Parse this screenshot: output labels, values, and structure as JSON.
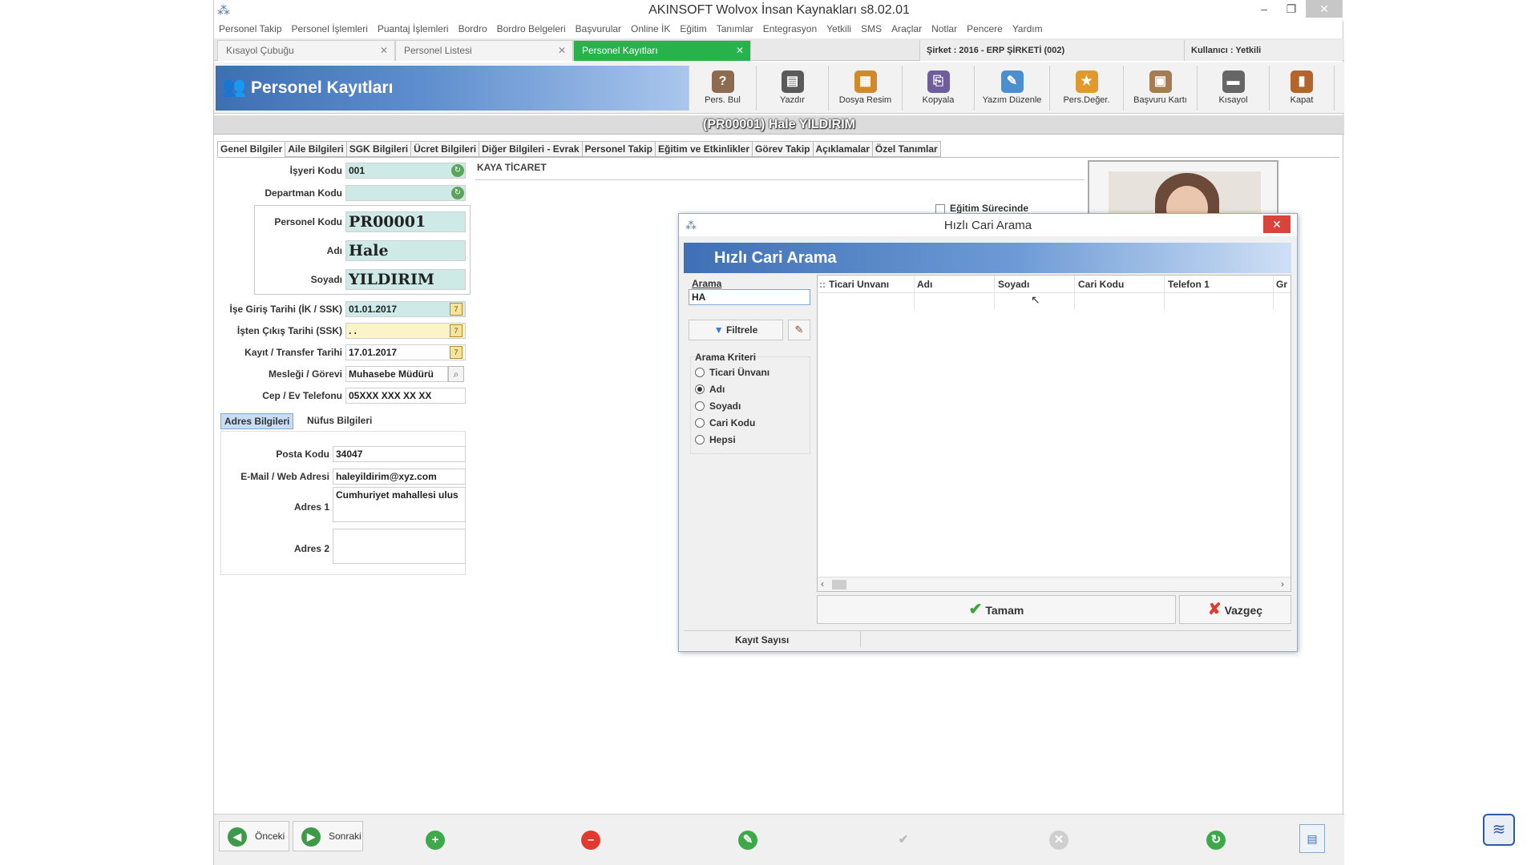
{
  "window": {
    "title": "AKINSOFT Wolvox İnsan Kaynakları s8.02.01"
  },
  "menu": [
    "Personel Takip",
    "Personel İşlemleri",
    "Puantaj İşlemleri",
    "Bordro",
    "Bordro Belgeleri",
    "Başvurular",
    "Online İK",
    "Eğitim",
    "Tanımlar",
    "Entegrasyon",
    "Yetkili",
    "SMS",
    "Araçlar",
    "Notlar",
    "Pencere",
    "Yardım"
  ],
  "doc_tabs": [
    {
      "label": "Kısayol Çubuğu"
    },
    {
      "label": "Personel Listesi"
    },
    {
      "label": "Personel Kayıtları"
    }
  ],
  "company_info": "Şirket : 2016 - ERP ŞİRKETİ (002)",
  "user_info": "Kullanıcı : Yetkili",
  "page": {
    "title": "Personel Kayıtları"
  },
  "toolbar": [
    {
      "label": "Pers. Bul",
      "icon": "person-search-icon"
    },
    {
      "label": "Yazdır",
      "icon": "printer-icon"
    },
    {
      "label": "Dosya Resim",
      "icon": "folder-image-icon"
    },
    {
      "label": "Kopyala",
      "icon": "copy-person-icon"
    },
    {
      "label": "Yazım Düzenle",
      "icon": "edit-document-icon"
    },
    {
      "label": "Pers.Değer.",
      "icon": "evaluation-icon"
    },
    {
      "label": "Başvuru Kartı",
      "icon": "application-card-icon"
    },
    {
      "label": "Kısayol",
      "icon": "shortcut-icon"
    },
    {
      "label": "Kapat",
      "icon": "exit-door-icon"
    }
  ],
  "record_title": "(PR00001) Hale YILDIRIM",
  "form_tabs": [
    "Genel Bilgiler",
    "Aile Bilgileri",
    "SGK Bilgileri",
    "Ücret Bilgileri",
    "Diğer Bilgileri - Evrak",
    "Personel Takip",
    "Eğitim ve Etkinlikler",
    "Görev Takip",
    "Açıklamalar",
    "Özel Tanımlar"
  ],
  "form": {
    "isyeri_kodu": {
      "label": "İşyeri Kodu",
      "value": "001"
    },
    "isyeri_adi": "KAYA TİCARET",
    "departman_kodu": {
      "label": "Departman Kodu",
      "value": ""
    },
    "egitim_surecinde": "Eğitim Sürecinde",
    "personel_kodu": {
      "label": "Personel Kodu",
      "value": "PR00001"
    },
    "adi": {
      "label": "Adı",
      "value": "Hale"
    },
    "soyadi": {
      "label": "Soyadı",
      "value": "YILDIRIM"
    },
    "ise_giris": {
      "label": "İşe Giriş Tarihi (İK / SSK)",
      "value": "01.01.2017"
    },
    "isten_cikis": {
      "label": "İşten Çıkış Tarihi (SSK)",
      "value": ". ."
    },
    "kayit_transfer": {
      "label": "Kayıt / Transfer Tarihi",
      "value": "17.01.2017"
    },
    "meslegi": {
      "label": "Mesleği / Görevi",
      "value": "Muhasebe Müdürü"
    },
    "telefon": {
      "label": "Cep / Ev Telefonu",
      "value": "05XXX XXX XX XX"
    },
    "sub_tabs": [
      "Adres Bilgileri",
      "Nüfus Bilgileri"
    ],
    "posta_kodu": {
      "label": "Posta Kodu",
      "value": "34047"
    },
    "email": {
      "label": "E-Mail / Web Adresi",
      "value": "haleyildirim@xyz.com"
    },
    "adres1": {
      "label": "Adres 1",
      "value": "Cumhuriyet mahallesi ulus"
    },
    "adres2": {
      "label": "Adres 2",
      "value": ""
    }
  },
  "dialog": {
    "title": "Hızlı Cari Arama",
    "banner": "Hızlı Cari Arama",
    "search_label": "Arama",
    "search_value": "HA",
    "filter_button": "Filtrele",
    "criteria_title": "Arama Kriteri",
    "criteria": [
      {
        "label": "Ticari Ünvanı",
        "selected": false
      },
      {
        "label": "Adı",
        "selected": true
      },
      {
        "label": "Soyadı",
        "selected": false
      },
      {
        "label": "Cari Kodu",
        "selected": false
      },
      {
        "label": "Hepsi",
        "selected": false
      }
    ],
    "columns": [
      "Ticari Unvanı",
      "Adı",
      "Soyadı",
      "Cari Kodu",
      "Telefon 1",
      "Gr"
    ],
    "ok_button": "Tamam",
    "cancel_button": "Vazgeç",
    "status_label": "Kayıt Sayısı"
  },
  "bottom": {
    "prev": "Önceki",
    "next": "Sonraki"
  },
  "colors": {
    "accent_green": "#28b24b",
    "header_blue": "#3d6fb3",
    "close_red": "#d9433a"
  }
}
